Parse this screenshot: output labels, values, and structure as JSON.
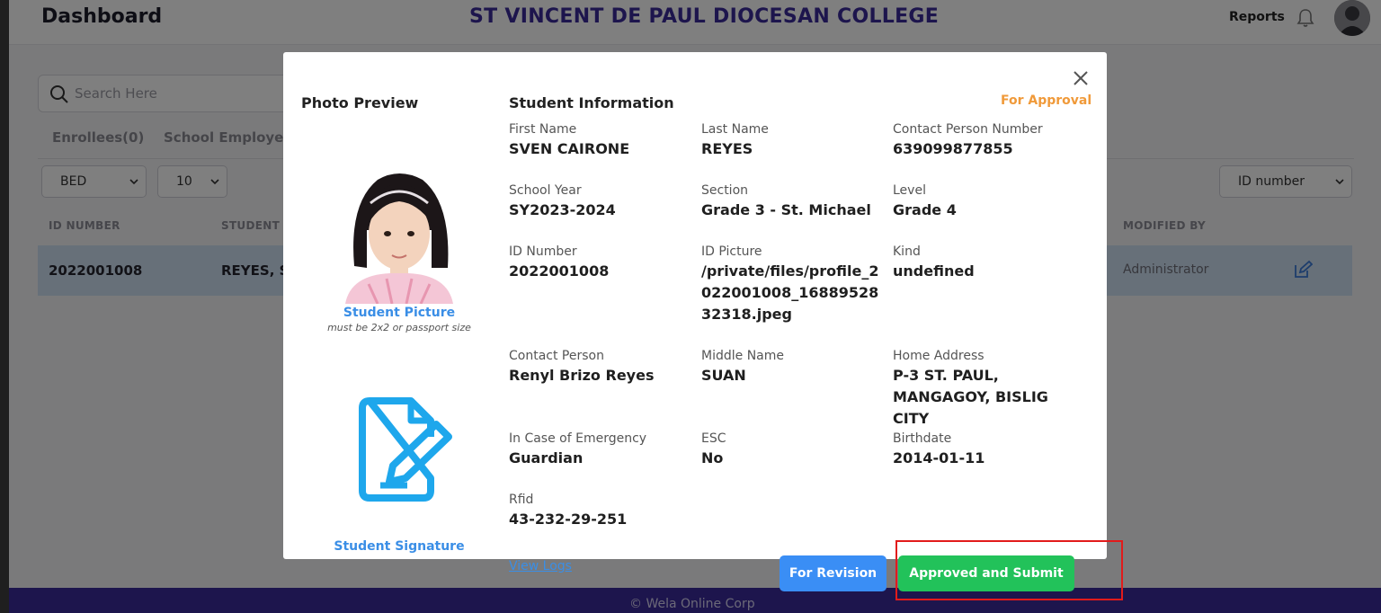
{
  "app": {
    "title": "Dashboard",
    "school": "ST VINCENT DE PAUL DIOCESAN COLLEGE",
    "reports": "Reports"
  },
  "search": {
    "placeholder": "Search Here"
  },
  "tabs": [
    "Enrollees(0)",
    "School Employees"
  ],
  "filters": {
    "department": "BED",
    "page_size": "10",
    "sort_by": "ID number"
  },
  "table": {
    "headers": [
      "ID NUMBER",
      "STUDENT N",
      "MODIFIED BY"
    ],
    "rows": [
      {
        "id": "2022001008",
        "name": "REYES, SV",
        "modified_by": "Administrator"
      }
    ]
  },
  "footer": "© Wela Online Corp",
  "modal": {
    "photo_title": "Photo Preview",
    "picture_label": "Student Picture",
    "picture_note": "must be 2x2 or passport size",
    "signature_label": "Student Signature",
    "info_title": "Student Information",
    "status": "For Approval",
    "fields": {
      "first_name": {
        "label": "First Name",
        "value": "SVEN CAIRONE"
      },
      "last_name": {
        "label": "Last Name",
        "value": "REYES"
      },
      "contact_number": {
        "label": "Contact Person Number",
        "value": "639099877855"
      },
      "school_year": {
        "label": "School Year",
        "value": "SY2023-2024"
      },
      "section": {
        "label": "Section",
        "value": "Grade 3 - St. Michael"
      },
      "level": {
        "label": "Level",
        "value": "Grade 4"
      },
      "id_number": {
        "label": "ID Number",
        "value": "2022001008"
      },
      "id_picture": {
        "label": "ID Picture",
        "value": "/private/files/profile_2022001008_1688952832318.jpeg"
      },
      "kind": {
        "label": "Kind",
        "value": "undefined"
      },
      "contact_person": {
        "label": "Contact Person",
        "value": "Renyl Brizo Reyes"
      },
      "middle_name": {
        "label": "Middle Name",
        "value": "SUAN"
      },
      "home_address": {
        "label": "Home Address",
        "value": "P-3 ST. PAUL, MANGAGOY, BISLIG CITY"
      },
      "emergency": {
        "label": "In Case of Emergency",
        "value": "Guardian"
      },
      "esc": {
        "label": "ESC",
        "value": "No"
      },
      "birthdate": {
        "label": "Birthdate",
        "value": "2014-01-11"
      },
      "rfid": {
        "label": "Rfid",
        "value": "43-232-29-251"
      }
    },
    "view_logs": "View Logs",
    "for_revision": "For Revision",
    "approve": "Approved and Submit"
  },
  "colors": {
    "brand": "#3b2a9a",
    "status": "#f09a3a",
    "link": "#3a8ee6",
    "approve": "#22c25a",
    "revision": "#3a8ef5",
    "highlight": "#e21b1b"
  }
}
